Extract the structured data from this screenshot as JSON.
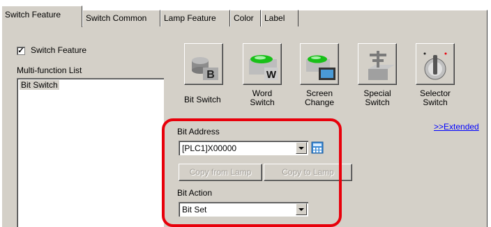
{
  "tabs": [
    "Switch Feature",
    "Switch Common",
    "Lamp Feature",
    "Color",
    "Label"
  ],
  "active_tab": "Switch Feature",
  "switch_feature_checkbox": {
    "label": "Switch Feature",
    "checked": true,
    "mark": "✓"
  },
  "multi_function_list": {
    "label": "Multi-function List",
    "items": [
      "Bit Switch"
    ]
  },
  "switch_types": [
    {
      "icon": "bit-switch-icon",
      "label": "Bit Switch"
    },
    {
      "icon": "word-switch-icon",
      "label_line1": "Word",
      "label_line2": "Switch"
    },
    {
      "icon": "screen-change-icon",
      "label_line1": "Screen",
      "label_line2": "Change"
    },
    {
      "icon": "special-switch-icon",
      "label_line1": "Special",
      "label_line2": "Switch"
    },
    {
      "icon": "selector-switch-icon",
      "label_line1": "Selector",
      "label_line2": "Switch"
    }
  ],
  "extended_link": ">>Extended",
  "bit_address": {
    "label": "Bit Address",
    "value": "[PLC1]X00000"
  },
  "copy_from_lamp": "Copy from Lamp",
  "copy_to_lamp": "Copy to Lamp",
  "bit_action": {
    "label": "Bit Action",
    "value": "Bit Set"
  },
  "colors": {
    "highlight": "#e8000b",
    "face": "#d4d0c8",
    "link": "#0000ff",
    "green": "#18c018"
  }
}
